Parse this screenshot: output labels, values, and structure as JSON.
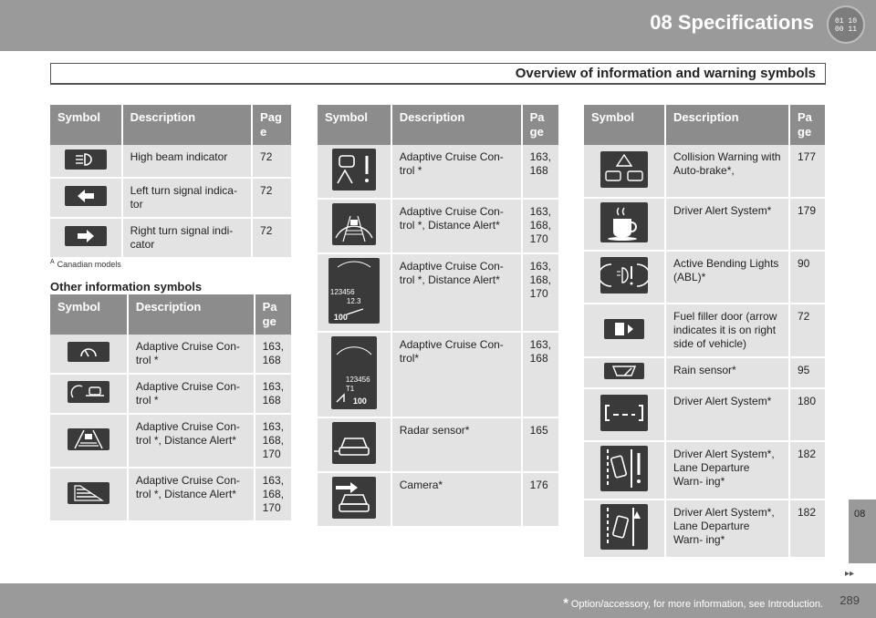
{
  "header": {
    "chapter_title": "08 Specifications",
    "logo_text_top": "01 10",
    "logo_text_bottom": "00 11"
  },
  "subtitle": "Overview of information and warning symbols",
  "columns": {
    "symbol": "Symbol",
    "description": "Description",
    "page_a": "Pag e",
    "page_b": "Pa ge"
  },
  "table1": {
    "rows": [
      {
        "icon": "high-beam-icon",
        "description": "High beam indicator",
        "page": "72"
      },
      {
        "icon": "left-turn-signal-icon",
        "description": "Left turn signal indica- tor",
        "page": "72"
      },
      {
        "icon": "right-turn-signal-icon",
        "description": "Right turn signal indi- cator",
        "page": "72"
      }
    ]
  },
  "footnote": {
    "marker": "A",
    "text": "Canadian models"
  },
  "other_heading": "Other information symbols",
  "table2": {
    "rows": [
      {
        "icon": "cruise-control-gauge-icon",
        "description": "Adaptive Cruise Con- trol *",
        "page": "163, 168"
      },
      {
        "icon": "cruise-control-car-icon",
        "description": "Adaptive Cruise Con- trol *",
        "page": "163, 168"
      },
      {
        "icon": "distance-alert-road-icon",
        "description": "Adaptive Cruise Con- trol *, Distance Alert*",
        "page": "163, 168, 170"
      },
      {
        "icon": "distance-bars-icon",
        "description": "Adaptive Cruise Con- trol *, Distance Alert*",
        "page": "163, 168, 170"
      }
    ]
  },
  "table3": {
    "rows": [
      {
        "icon": "cruise-warning-car-icon",
        "description": "Adaptive Cruise Con- trol *",
        "page": "163, 168"
      },
      {
        "icon": "distance-alert-car-road-icon",
        "description": "Adaptive Cruise Con- trol *, Distance Alert*",
        "page": "163, 168, 170"
      },
      {
        "icon": "speedometer-display-icon",
        "description": "Adaptive Cruise Con- trol *, Distance Alert*",
        "page": "163, 168, 170",
        "display": {
          "odo": "123456",
          "trip": "12.3",
          "speed": "100"
        }
      },
      {
        "icon": "speedometer-display-2-icon",
        "description": "Adaptive Cruise Con- trol*",
        "page": "163, 168",
        "display": {
          "odo": "123456",
          "trip": "T1",
          "speed": "100"
        }
      },
      {
        "icon": "radar-sensor-icon",
        "description": "Radar sensor*",
        "page": "165"
      },
      {
        "icon": "camera-icon",
        "description": "Camera*",
        "page": "176"
      }
    ]
  },
  "table4": {
    "rows": [
      {
        "icon": "collision-warning-icon",
        "description": "Collision Warning with Auto-brake*,",
        "page": "177"
      },
      {
        "icon": "coffee-cup-icon",
        "description": "Driver Alert System*",
        "page": "179"
      },
      {
        "icon": "active-bending-lights-icon",
        "description": "Active Bending Lights (ABL)*",
        "page": "90"
      },
      {
        "icon": "fuel-filler-icon",
        "description": "Fuel filler door (arrow indicates it is on right side of vehicle)",
        "page": "72"
      },
      {
        "icon": "rain-sensor-icon",
        "description": "Rain sensor*",
        "page": "95"
      },
      {
        "icon": "driver-alert-lane-icon",
        "description": "Driver Alert System*",
        "page": "180"
      },
      {
        "icon": "lane-departure-icon",
        "description": "Driver Alert System*, Lane Departure Warn- ing*",
        "page": "182"
      },
      {
        "icon": "lane-departure-2-icon",
        "description": "Driver Alert System*, Lane Departure Warn- ing*",
        "page": "182"
      }
    ]
  },
  "side_tab": "08",
  "footer": {
    "star": "*",
    "note": "Option/accessory, for more information, see Introduction.",
    "page": "289"
  }
}
